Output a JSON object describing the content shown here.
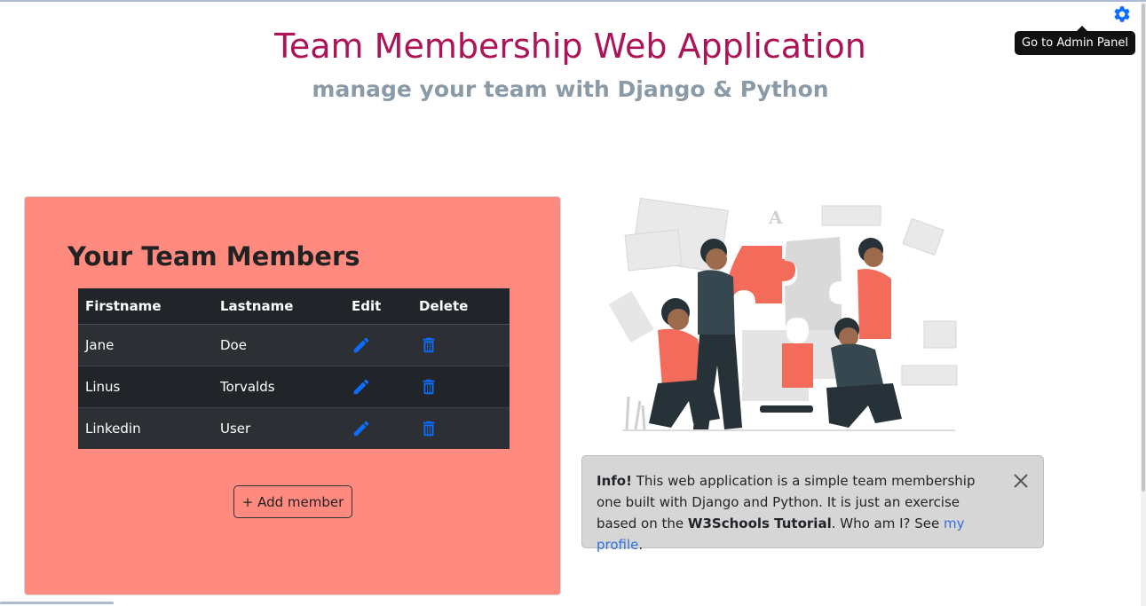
{
  "header": {
    "title": "Team Membership Web Application",
    "subtitle": "manage your team with Django & Python",
    "admin_tooltip": "Go to Admin Panel"
  },
  "team": {
    "heading": "Your Team Members",
    "columns": [
      "Firstname",
      "Lastname",
      "Edit",
      "Delete"
    ],
    "members": [
      {
        "firstname": "Jane",
        "lastname": "Doe"
      },
      {
        "firstname": "Linus",
        "lastname": "Torvalds"
      },
      {
        "firstname": "Linkedin",
        "lastname": "User"
      }
    ],
    "add_button": "+ Add member"
  },
  "info": {
    "label": "Info!",
    "text1": "This web application is a simple team membership one built with Django and Python. It is just an exercise based on the",
    "tutorial": "W3Schools Tutorial",
    "text2": ". Who am I? See",
    "link": "my profile",
    "text3": "."
  },
  "colors": {
    "title": "#ad1457",
    "subtitle": "#8a9aa6",
    "card": "#ff8a80",
    "table": "#212529",
    "accent": "#0d6efd",
    "illustration": "#f26b5b"
  },
  "icons": {
    "settings": "gear-icon",
    "edit": "pencil-icon",
    "delete": "trash-icon",
    "close": "close-icon"
  }
}
